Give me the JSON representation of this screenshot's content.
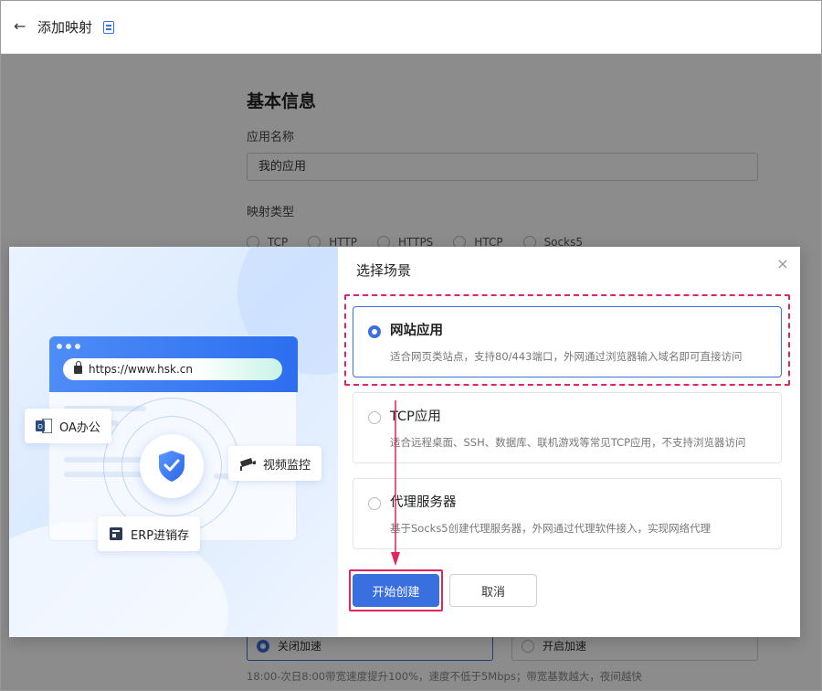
{
  "header": {
    "title": "添加映射"
  },
  "basic": {
    "section_title": "基本信息",
    "app_name_label": "应用名称",
    "app_name_value": "我的应用",
    "mapping_type_label": "映射类型",
    "mapping_types": [
      "TCP",
      "HTTP",
      "HTTPS",
      "HTCP",
      "Socks5"
    ]
  },
  "acceleration": {
    "options": [
      "关闭加速",
      "开启加速"
    ],
    "selected": "关闭加速",
    "note": "18:00-次日8:00带宽速度提升100%，速度不低于5Mbps；带宽基数越大，夜间越快"
  },
  "modal": {
    "title": "选择场景",
    "illustration": {
      "url": "https://www.hsk.cn",
      "tags": [
        "OA办公",
        "视频监控",
        "ERP进销存"
      ]
    },
    "scenes": [
      {
        "title": "网站应用",
        "desc": "适合网页类站点，支持80/443端口，外网通过浏览器输入域名即可直接访问",
        "selected": true
      },
      {
        "title": "TCP应用",
        "desc": "适合远程桌面、SSH、数据库、联机游戏等常见TCP应用，不支持浏览器访问",
        "selected": false
      },
      {
        "title": "代理服务器",
        "desc": "基于Socks5创建代理服务器，外网通过代理软件接入，实现网络代理",
        "selected": false
      }
    ],
    "primary_button": "开始创建",
    "cancel_button": "取消"
  },
  "colors": {
    "accent": "#3a6fe0",
    "highlight": "#e0245e"
  }
}
